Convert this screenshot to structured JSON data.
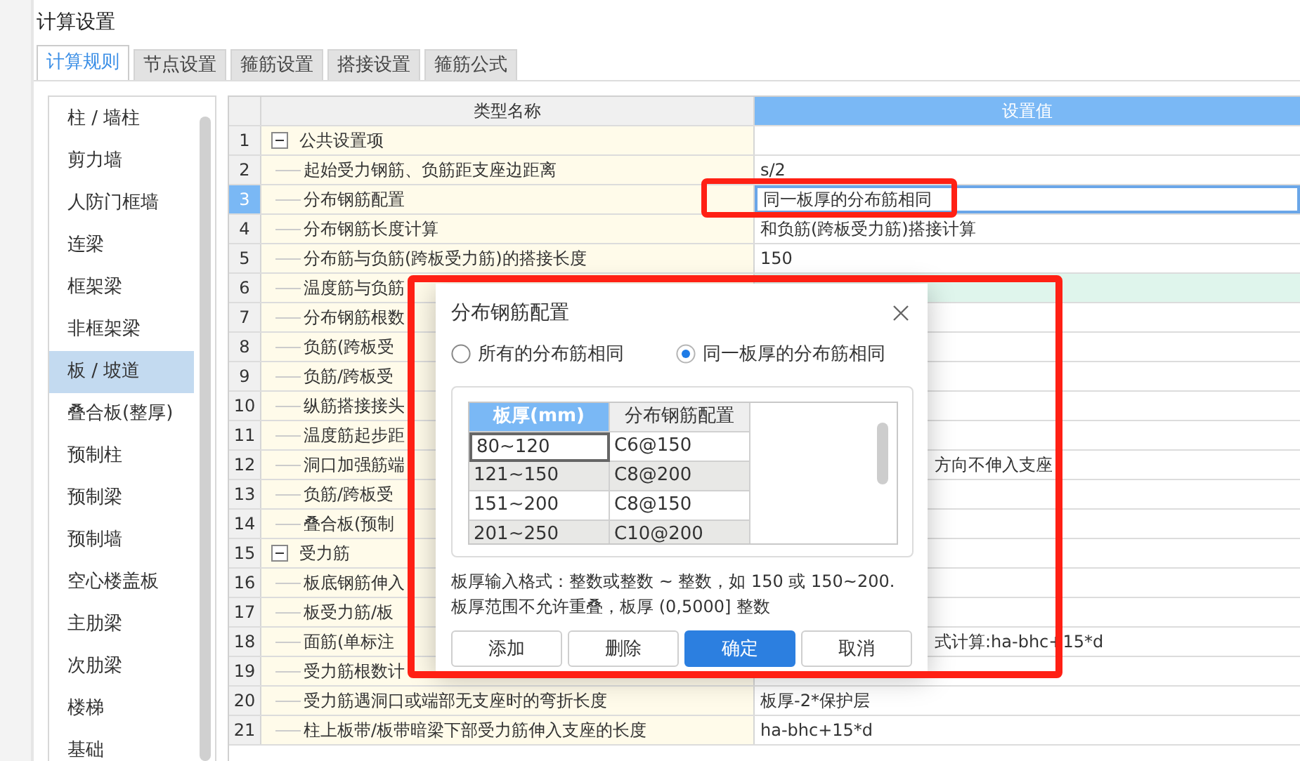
{
  "window": {
    "title": "计算设置"
  },
  "tabs": [
    {
      "label": "计算规则",
      "selected": true
    },
    {
      "label": "节点设置",
      "selected": false
    },
    {
      "label": "箍筋设置",
      "selected": false
    },
    {
      "label": "搭接设置",
      "selected": false
    },
    {
      "label": "箍筋公式",
      "selected": false
    }
  ],
  "categories": [
    {
      "label": "柱 / 墙柱",
      "selected": false
    },
    {
      "label": "剪力墙",
      "selected": false
    },
    {
      "label": "人防门框墙",
      "selected": false
    },
    {
      "label": "连梁",
      "selected": false
    },
    {
      "label": "框架梁",
      "selected": false
    },
    {
      "label": "非框架梁",
      "selected": false
    },
    {
      "label": "板 / 坡道",
      "selected": true
    },
    {
      "label": "叠合板(整厚)",
      "selected": false
    },
    {
      "label": "预制柱",
      "selected": false
    },
    {
      "label": "预制梁",
      "selected": false
    },
    {
      "label": "预制墙",
      "selected": false
    },
    {
      "label": "空心楼盖板",
      "selected": false
    },
    {
      "label": "主肋梁",
      "selected": false
    },
    {
      "label": "次肋梁",
      "selected": false
    },
    {
      "label": "楼梯",
      "selected": false
    },
    {
      "label": "基础",
      "selected": false
    }
  ],
  "grid": {
    "columns": [
      "类型名称",
      "设置值"
    ],
    "rows": [
      {
        "number": "1",
        "kind": "group",
        "name": "公共设置项",
        "expanded": true,
        "selected": false,
        "highlighted": false
      },
      {
        "number": "2",
        "kind": "item",
        "name": "起始受力钢筋、负筋距支座边距离",
        "value": "s/2",
        "selected": false,
        "highlighted": false
      },
      {
        "number": "3",
        "kind": "item",
        "name": "分布钢筋配置",
        "value": "同一板厚的分布筋相同",
        "selected": true,
        "highlighted": false
      },
      {
        "number": "4",
        "kind": "item",
        "name": "分布钢筋长度计算",
        "value": "和负筋(跨板受力筋)搭接计算",
        "selected": false,
        "highlighted": false
      },
      {
        "number": "5",
        "kind": "item",
        "name": "分布筋与负筋(跨板受力筋)的搭接长度",
        "value": "150",
        "selected": false,
        "highlighted": false
      },
      {
        "number": "6",
        "kind": "item",
        "name": "温度筋与负筋",
        "selected": false,
        "highlighted": true
      },
      {
        "number": "7",
        "kind": "item",
        "name": "分布钢筋根数",
        "selected": false,
        "highlighted": false
      },
      {
        "number": "8",
        "kind": "item",
        "name": "负筋(跨板受",
        "selected": false,
        "highlighted": false
      },
      {
        "number": "9",
        "kind": "item",
        "name": "负筋/跨板受",
        "selected": false,
        "highlighted": false
      },
      {
        "number": "10",
        "kind": "item",
        "name": "纵筋搭接接头",
        "selected": false,
        "highlighted": false
      },
      {
        "number": "11",
        "kind": "item",
        "name": "温度筋起步距",
        "selected": false,
        "highlighted": false
      },
      {
        "number": "12",
        "kind": "item",
        "name": "洞口加强筋端",
        "value": "方向不伸入支座",
        "selected": false,
        "highlighted": false
      },
      {
        "number": "13",
        "kind": "item",
        "name": "负筋/跨板受",
        "selected": false,
        "highlighted": false
      },
      {
        "number": "14",
        "kind": "item",
        "name": "叠合板(预制",
        "selected": false,
        "highlighted": false
      },
      {
        "number": "15",
        "kind": "group",
        "name": "受力筋",
        "expanded": true,
        "selected": false,
        "highlighted": false
      },
      {
        "number": "16",
        "kind": "item",
        "name": "板底钢筋伸入",
        "selected": false,
        "highlighted": false
      },
      {
        "number": "17",
        "kind": "item",
        "name": "板受力筋/板",
        "selected": false,
        "highlighted": false
      },
      {
        "number": "18",
        "kind": "item",
        "name": "面筋(单标注",
        "value": "式计算:ha-bhc+15*d",
        "selected": false,
        "highlighted": false
      },
      {
        "number": "19",
        "kind": "item",
        "name": "受力筋根数计",
        "selected": false,
        "highlighted": false
      },
      {
        "number": "20",
        "kind": "item",
        "name": "受力筋遇洞口或端部无支座时的弯折长度",
        "value": "板厚-2*保护层",
        "selected": false,
        "highlighted": false
      },
      {
        "number": "21",
        "kind": "item",
        "name": "柱上板带/板带暗梁下部受力筋伸入支座的长度",
        "value": "ha-bhc+15*d",
        "selected": false,
        "highlighted": false
      }
    ]
  },
  "dialog": {
    "title": "分布钢筋配置",
    "radios": [
      {
        "label": "所有的分布筋相同",
        "selected": false
      },
      {
        "label": "同一板厚的分布筋相同",
        "selected": true
      }
    ],
    "table": {
      "columns": [
        {
          "label": "板厚(mm)",
          "selected": true
        },
        {
          "label": "分布钢筋配置",
          "selected": false
        }
      ],
      "rows": [
        {
          "cells": [
            "80~120",
            "C6@150"
          ],
          "focused": true
        },
        {
          "cells": [
            "121~150",
            "C8@200"
          ],
          "focused": false
        },
        {
          "cells": [
            "151~200",
            "C8@150"
          ],
          "focused": false
        },
        {
          "cells": [
            "201~250",
            "C10@200"
          ],
          "focused": false
        }
      ]
    },
    "note": [
      "板厚输入格式：整数或整数 ~ 整数，如 150 或 150~200.",
      "板厚范围不允许重叠，板厚 (0,5000] 整数"
    ],
    "buttons": [
      {
        "label": "添加",
        "kind": "default"
      },
      {
        "label": "删除",
        "kind": "default"
      },
      {
        "label": "确定",
        "kind": "primary"
      },
      {
        "label": "取消",
        "kind": "default"
      }
    ]
  }
}
